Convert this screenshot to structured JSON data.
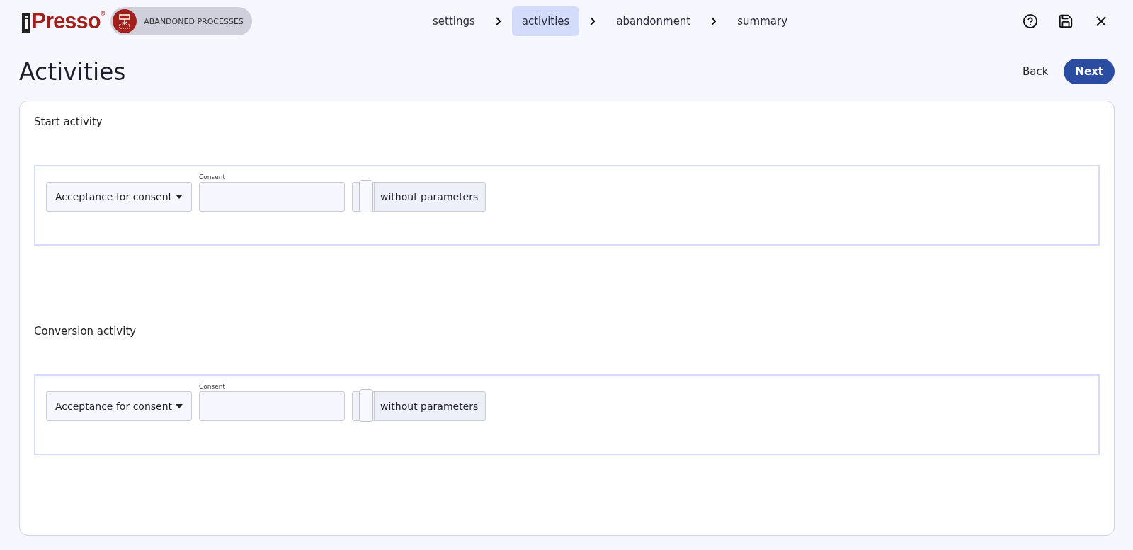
{
  "logo": {
    "mark": "i",
    "name": "Presso",
    "registered": "®"
  },
  "module_badge": {
    "label": "ABANDONED PROCESSES"
  },
  "steps": [
    {
      "label": "settings",
      "selected": false
    },
    {
      "label": "activities",
      "selected": true
    },
    {
      "label": "abandonment",
      "selected": false
    },
    {
      "label": "summary",
      "selected": false
    }
  ],
  "page_title": "Activities",
  "actions": {
    "back": "Back",
    "next": "Next"
  },
  "sections": [
    {
      "title": "Start activity",
      "select": "Acceptance for consent",
      "field_label": "Consent",
      "toggle": {
        "on": false,
        "label": "without parameters"
      }
    },
    {
      "title": "Conversion activity",
      "select": "Acceptance for consent",
      "field_label": "Consent",
      "toggle": {
        "on": false,
        "label": "without parameters"
      }
    }
  ]
}
